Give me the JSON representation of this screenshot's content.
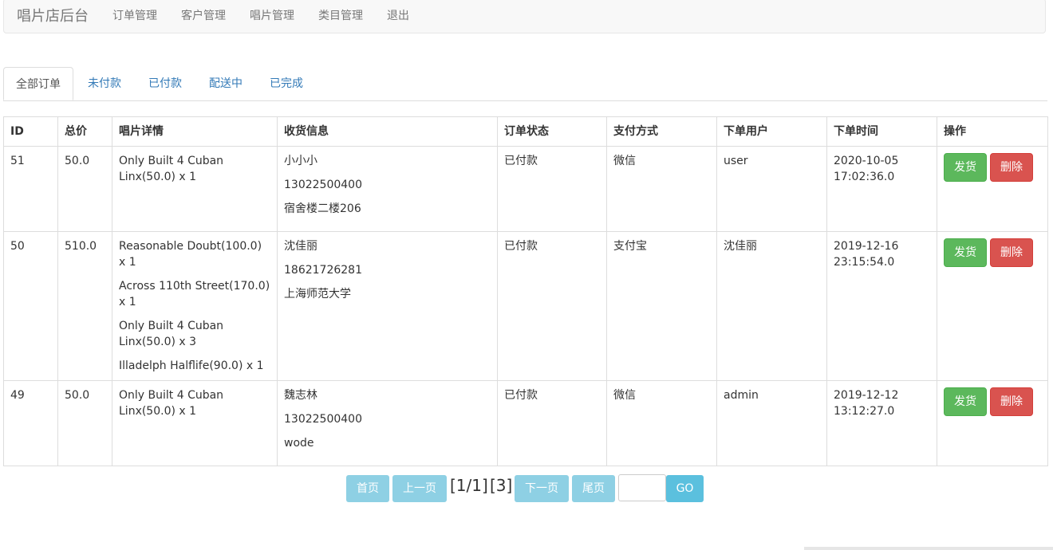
{
  "nav": {
    "brand": "唱片店后台",
    "items": [
      "订单管理",
      "客户管理",
      "唱片管理",
      "类目管理",
      "退出"
    ]
  },
  "tabs": [
    "全部订单",
    "未付款",
    "已付款",
    "配送中",
    "已完成"
  ],
  "active_tab": "全部订单",
  "table": {
    "headers": [
      "ID",
      "总价",
      "唱片详情",
      "收货信息",
      "订单状态",
      "支付方式",
      "下单用户",
      "下单时间",
      "操作"
    ],
    "rows": [
      {
        "id": "51",
        "total": "50.0",
        "details": [
          "Only Built 4 Cuban Linx(50.0) x 1"
        ],
        "shipping": [
          "小小小",
          "13022500400",
          "宿舍楼二楼206"
        ],
        "status": "已付款",
        "payment": "微信",
        "user": "user",
        "time": "2020-10-05 17:02:36.0"
      },
      {
        "id": "50",
        "total": "510.0",
        "details": [
          "Reasonable Doubt(100.0) x 1",
          "Across 110th Street(170.0) x 1",
          "Only Built 4 Cuban Linx(50.0) x 3",
          "Illadelph Halflife(90.0) x 1"
        ],
        "shipping": [
          "沈佳丽",
          "18621726281",
          "上海师范大学"
        ],
        "status": "已付款",
        "payment": "支付宝",
        "user": "沈佳丽",
        "time": "2019-12-16 23:15:54.0"
      },
      {
        "id": "49",
        "total": "50.0",
        "details": [
          "Only Built 4 Cuban Linx(50.0) x 1"
        ],
        "shipping": [
          "魏志林",
          "13022500400",
          "wode"
        ],
        "status": "已付款",
        "payment": "微信",
        "user": "admin",
        "time": "2019-12-12 13:12:27.0"
      }
    ],
    "ship_label": "发货",
    "delete_label": "删除"
  },
  "pager": {
    "first": "首页",
    "prev": "上一页",
    "page_info": "[1/1]",
    "count": "[3]",
    "next": "下一页",
    "last": "尾页",
    "input_value": "",
    "go": "GO"
  },
  "colors": {
    "status": "#d9534f",
    "ship_button": "#5cb85c",
    "delete_button": "#d9534f",
    "pager_button": "#8ed0e4",
    "go_button": "#5bc0de",
    "link": "#337ab7"
  }
}
